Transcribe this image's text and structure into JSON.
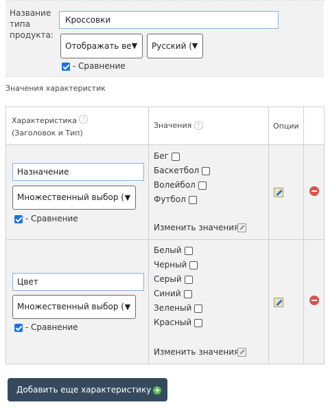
{
  "product_type": {
    "label": "Название типа продукта:",
    "name_value": "Кроссовки",
    "display_select": "Отображать ве",
    "language_select": "Русский (",
    "compare_checked": true,
    "compare_label": "- Сравнение"
  },
  "section_title": "Значения характеристик",
  "table": {
    "headers": {
      "characteristic": "Характеристика",
      "characteristic_sub": "(Заголовок и Тип)",
      "values": "Значения",
      "options": "Опции"
    },
    "rows": [
      {
        "name": "Назначение",
        "type": "Множественный выбор (",
        "compare_checked": true,
        "compare_label": "- Сравнение",
        "values": [
          "Бег",
          "Баскетбол",
          "Волейбол",
          "Футбол"
        ],
        "edit_values_label": "Изменить значения"
      },
      {
        "name": "Цвет",
        "type": "Множественный выбор (",
        "compare_checked": true,
        "compare_label": "- Сравнение",
        "values": [
          "Белый",
          "Черный",
          "Серый",
          "Синий",
          "Зеленый",
          "Красный"
        ],
        "edit_values_label": "Изменить значения"
      }
    ]
  },
  "add_button_label": "Добавить еще характеристику",
  "colors": {
    "panel_bg": "#f2f2f2",
    "input_border": "#8ab0d6",
    "button_bg": "#354a5e",
    "delete_red": "#d9534f",
    "add_green": "#5cb85c",
    "checkbox_blue": "#1a73e8"
  },
  "icons": [
    "help-icon",
    "edit-icon",
    "delete-icon",
    "plus-icon",
    "pencil-icon",
    "chevron-down-icon"
  ]
}
